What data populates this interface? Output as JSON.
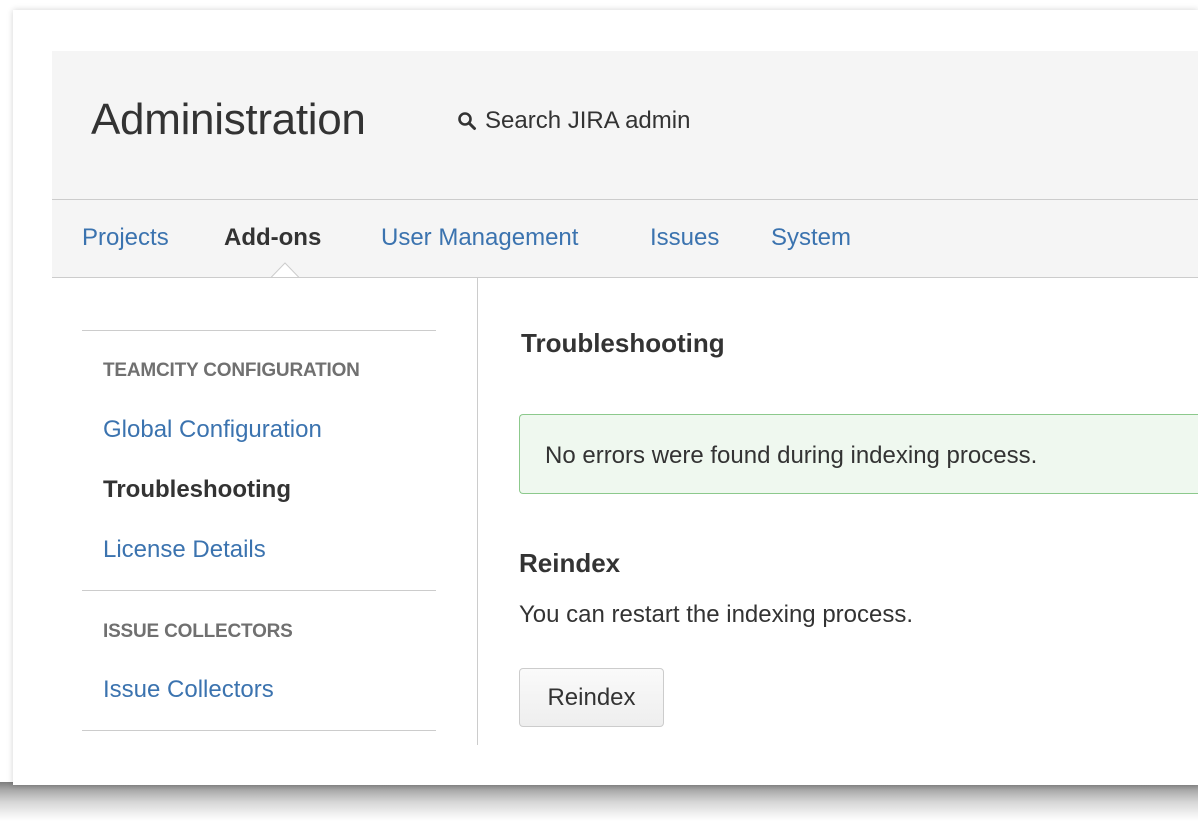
{
  "header": {
    "title": "Administration",
    "search_label": "Search JIRA admin"
  },
  "tabs": [
    {
      "label": "Projects",
      "active": false
    },
    {
      "label": "Add-ons",
      "active": true
    },
    {
      "label": "User Management",
      "active": false
    },
    {
      "label": "Issues",
      "active": false
    },
    {
      "label": "System",
      "active": false
    }
  ],
  "sidebar": {
    "sections": [
      {
        "heading": "TEAMCITY CONFIGURATION",
        "items": [
          {
            "label": "Global Configuration",
            "active": false
          },
          {
            "label": "Troubleshooting",
            "active": true
          },
          {
            "label": "License Details",
            "active": false
          }
        ]
      },
      {
        "heading": "ISSUE COLLECTORS",
        "items": [
          {
            "label": "Issue Collectors",
            "active": false
          }
        ]
      }
    ]
  },
  "main": {
    "title": "Troubleshooting",
    "success_message": "No errors were found during indexing process.",
    "reindex": {
      "title": "Reindex",
      "description": "You can restart the indexing process.",
      "button_label": "Reindex"
    }
  },
  "colors": {
    "link": "#3b73af",
    "text": "#333333",
    "header_bg": "#f5f5f5",
    "success_bg": "#eff8ef",
    "success_border": "#8cc98c"
  },
  "icons": {
    "search": "search-icon"
  }
}
